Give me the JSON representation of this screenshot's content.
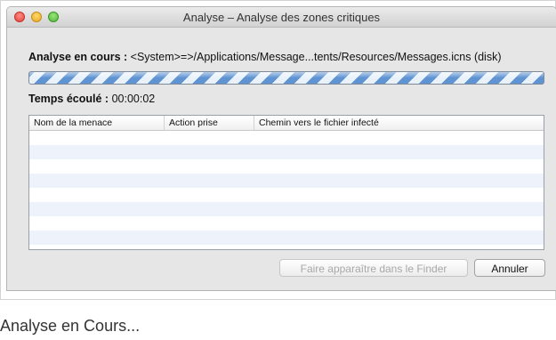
{
  "window": {
    "title": "Analyse – Analyse des zones critiques"
  },
  "scan": {
    "status_label": "Analyse en cours :",
    "current_path": "<System>=>/Applications/Message...tents/Resources/Messages.icns (disk)",
    "progress": "indeterminate",
    "elapsed_label": "Temps écoulé :",
    "elapsed_value": "00:00:02"
  },
  "table": {
    "columns": [
      "Nom de la menace",
      "Action prise",
      "Chemin vers le fichier infecté"
    ],
    "rows": []
  },
  "buttons": {
    "finder_label": "Faire apparaître dans le Finder",
    "cancel_label": "Annuler"
  },
  "caption": "Analyse en Cours..."
}
